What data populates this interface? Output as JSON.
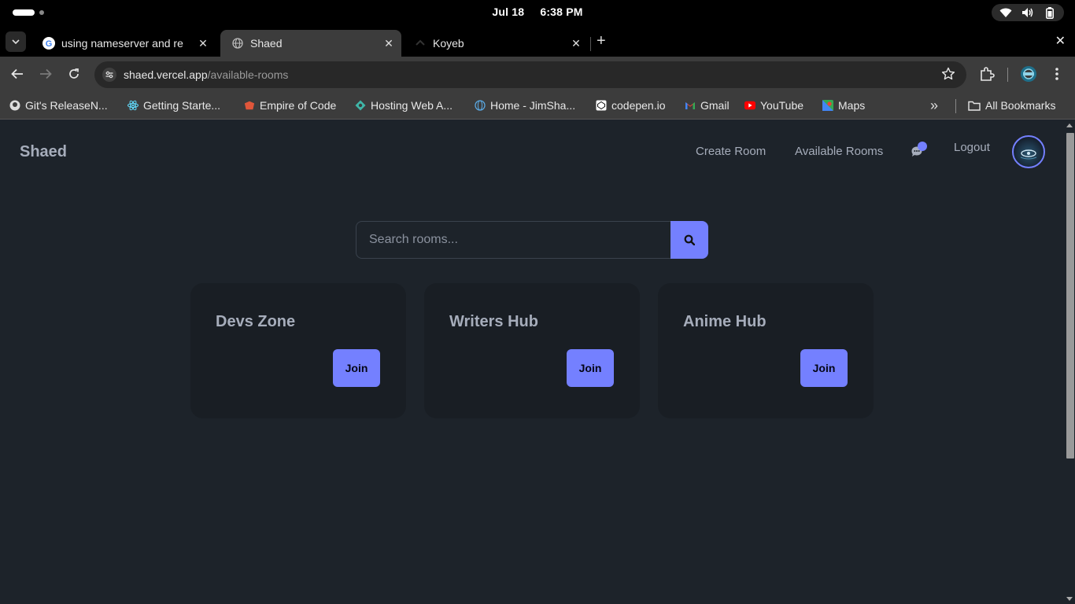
{
  "system": {
    "date": "Jul 18",
    "time": "6:38 PM",
    "icons": [
      "wifi-icon",
      "volume-icon",
      "battery-icon"
    ]
  },
  "tabs": [
    {
      "title": "using nameserver and re",
      "favicon": "google-icon",
      "active": false
    },
    {
      "title": "Shaed",
      "favicon": "globe-icon",
      "active": true
    },
    {
      "title": "Koyeb",
      "favicon": "koyeb-icon",
      "active": false
    }
  ],
  "toolbar": {
    "url_host": "shaed.vercel.app",
    "url_path": "/available-rooms"
  },
  "bookmarks": [
    {
      "label": "Git's ReleaseN...",
      "icon": "github-icon"
    },
    {
      "label": "Getting Starte...",
      "icon": "react-icon"
    },
    {
      "label": "Empire of Code",
      "icon": "empire-icon"
    },
    {
      "label": "Hosting Web A...",
      "icon": "hosting-icon"
    },
    {
      "label": "Home - JimSha...",
      "icon": "globe-icon"
    },
    {
      "label": "codepen.io",
      "icon": "codepen-icon"
    },
    {
      "label": "Gmail",
      "icon": "gmail-icon"
    },
    {
      "label": "YouTube",
      "icon": "youtube-icon"
    },
    {
      "label": "Maps",
      "icon": "maps-icon"
    }
  ],
  "all_bookmarks_label": "All Bookmarks",
  "app": {
    "brand": "Shaed",
    "nav": {
      "create_room": "Create Room",
      "available_rooms": "Available Rooms",
      "logout": "Logout"
    },
    "search": {
      "placeholder": "Search rooms..."
    },
    "rooms": [
      {
        "name": "Devs Zone",
        "action": "Join"
      },
      {
        "name": "Writers Hub",
        "action": "Join"
      },
      {
        "name": "Anime Hub",
        "action": "Join"
      }
    ],
    "colors": {
      "primary": "#7480ff",
      "base": "#1d232a",
      "card": "#191e24",
      "text": "#a6adbb"
    }
  }
}
